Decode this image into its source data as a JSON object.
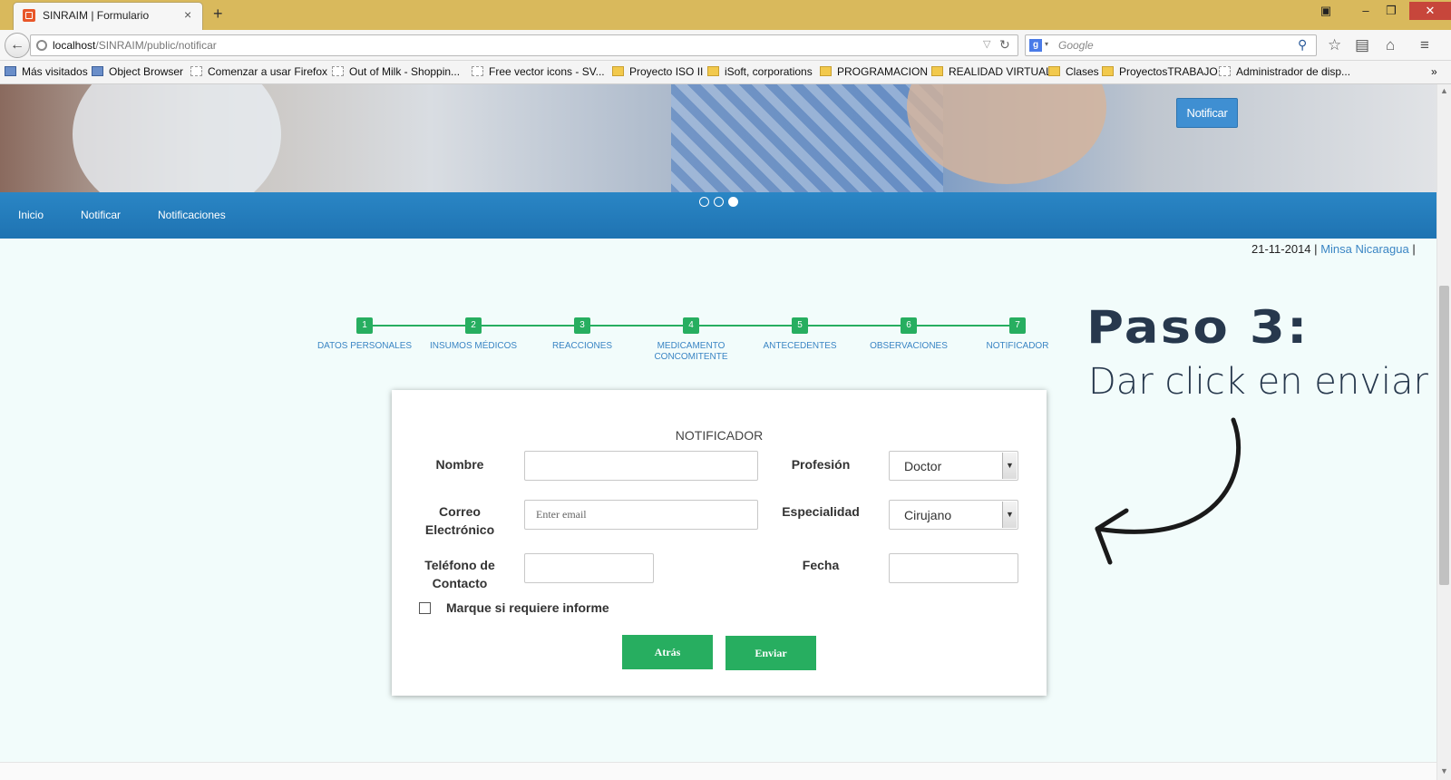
{
  "browser": {
    "tab_title": "SINRAIM | Formulario",
    "tab_close": "×",
    "new_tab": "+",
    "url_host": "localhost",
    "url_path": "/SINRAIM/public/notificar",
    "search_placeholder": "Google",
    "icons": [
      "back-arrow-icon",
      "globe-icon",
      "reload-icon",
      "google-icon",
      "magnifier-icon",
      "star-icon",
      "reading-list-icon",
      "home-icon",
      "menu-icon"
    ],
    "bookmarks": [
      {
        "label": "Más visitados",
        "icon": "blue"
      },
      {
        "label": "Object Browser",
        "icon": "blue"
      },
      {
        "label": "Comenzar a usar Firefox",
        "icon": "page"
      },
      {
        "label": "Out of Milk - Shoppin...",
        "icon": "page"
      },
      {
        "label": "Free vector icons - SV...",
        "icon": "page"
      },
      {
        "label": "Proyecto ISO II",
        "icon": "folder"
      },
      {
        "label": "iSoft, corporations",
        "icon": "folder"
      },
      {
        "label": "PROGRAMACION",
        "icon": "folder"
      },
      {
        "label": "REALIDAD VIRTUAL",
        "icon": "folder"
      },
      {
        "label": "Clases",
        "icon": "folder"
      },
      {
        "label": "ProyectosTRABAJO",
        "icon": "folder"
      },
      {
        "label": "Administrador de disp...",
        "icon": "page"
      }
    ],
    "bookmarks_more": "»"
  },
  "hero": {
    "notify_button": "Notificar",
    "carousel_dots": 3,
    "carousel_active": 3
  },
  "menu": {
    "items": [
      "Inicio",
      "Notificar",
      "Notificaciones"
    ]
  },
  "dateline": {
    "date": "21-11-2014",
    "sep": "|",
    "link": "Minsa Nicaragua",
    "sep2": "|"
  },
  "stepper": {
    "steps": [
      {
        "num": "1",
        "label": "DATOS PERSONALES"
      },
      {
        "num": "2",
        "label": "INSUMOS MÉDICOS"
      },
      {
        "num": "3",
        "label": "REACCIONES"
      },
      {
        "num": "4",
        "label": "MEDICAMENTO CONCOMITENTE"
      },
      {
        "num": "5",
        "label": "ANTECEDENTES"
      },
      {
        "num": "6",
        "label": "OBSERVACIONES"
      },
      {
        "num": "7",
        "label": "NOTIFICADOR"
      }
    ]
  },
  "annotation": {
    "title": "Paso 3:",
    "subtitle": "Dar click en enviar"
  },
  "form": {
    "title": "NOTIFICADOR",
    "nombre_label": "Nombre",
    "nombre_value": "",
    "correo_label": "Correo Electrónico",
    "correo_placeholder": "Enter email",
    "telefono_label": "Teléfono de Contacto",
    "telefono_value": "",
    "profesion_label": "Profesión",
    "profesion_value": "Doctor",
    "especialidad_label": "Especialidad",
    "especialidad_value": "Cirujano",
    "fecha_label": "Fecha",
    "fecha_value": "",
    "checkbox_label": "Marque si requiere informe",
    "checkbox_checked": false,
    "back_button": "Atrás",
    "send_button": "Enviar"
  },
  "colors": {
    "accent_green": "#27ae60",
    "menu_blue": "#2a86c5",
    "link_blue": "#3a85c4",
    "annotation": "#27384d"
  }
}
